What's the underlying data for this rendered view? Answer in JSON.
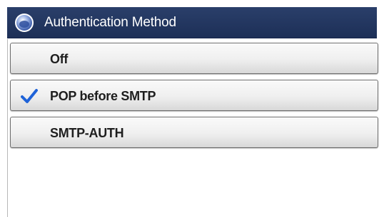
{
  "header": {
    "title": "Authentication Method",
    "icon": "settings-disc-icon"
  },
  "options": [
    {
      "label": "Off",
      "selected": false
    },
    {
      "label": "POP before SMTP",
      "selected": true
    },
    {
      "label": "SMTP-AUTH",
      "selected": false
    }
  ],
  "colors": {
    "title_bar": "#1d2f57",
    "check": "#1f63d8"
  }
}
